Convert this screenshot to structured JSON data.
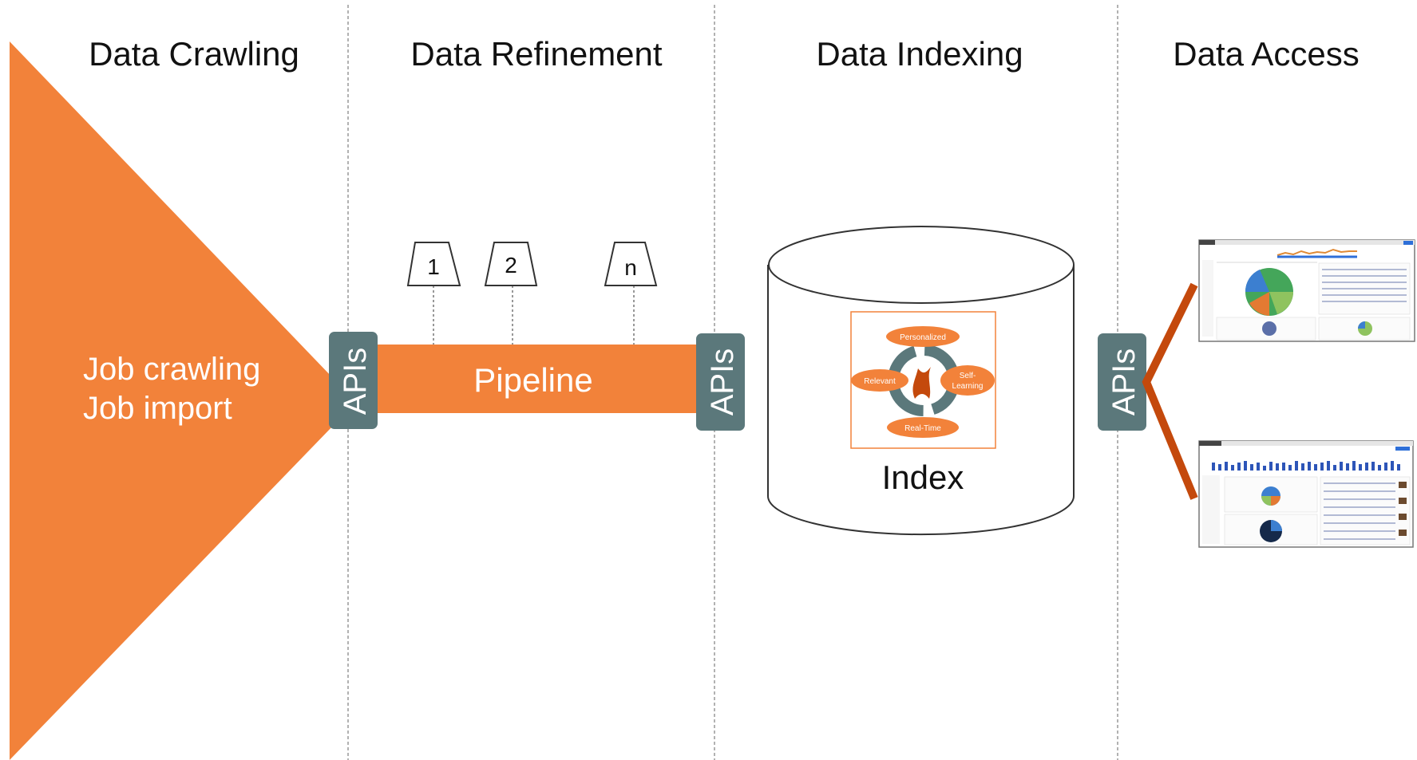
{
  "stages": [
    {
      "title": "Data Crawling"
    },
    {
      "title": "Data Refinement"
    },
    {
      "title": "Data Indexing"
    },
    {
      "title": "Data Access"
    }
  ],
  "crawling": {
    "line1": "Job crawling",
    "line2": "Job import"
  },
  "api_label": "APIs",
  "pipeline": {
    "label": "Pipeline",
    "filters": [
      "1",
      "2",
      "n"
    ]
  },
  "index": {
    "label": "Index",
    "cycle": {
      "top": "Personalized",
      "left": "Relevant",
      "right_line1": "Self-",
      "right_line2": "Learning",
      "bottom": "Real-Time"
    }
  },
  "colors": {
    "orange": "#F2823A",
    "slate": "#5B787B",
    "dark_orange": "#C4490C"
  }
}
